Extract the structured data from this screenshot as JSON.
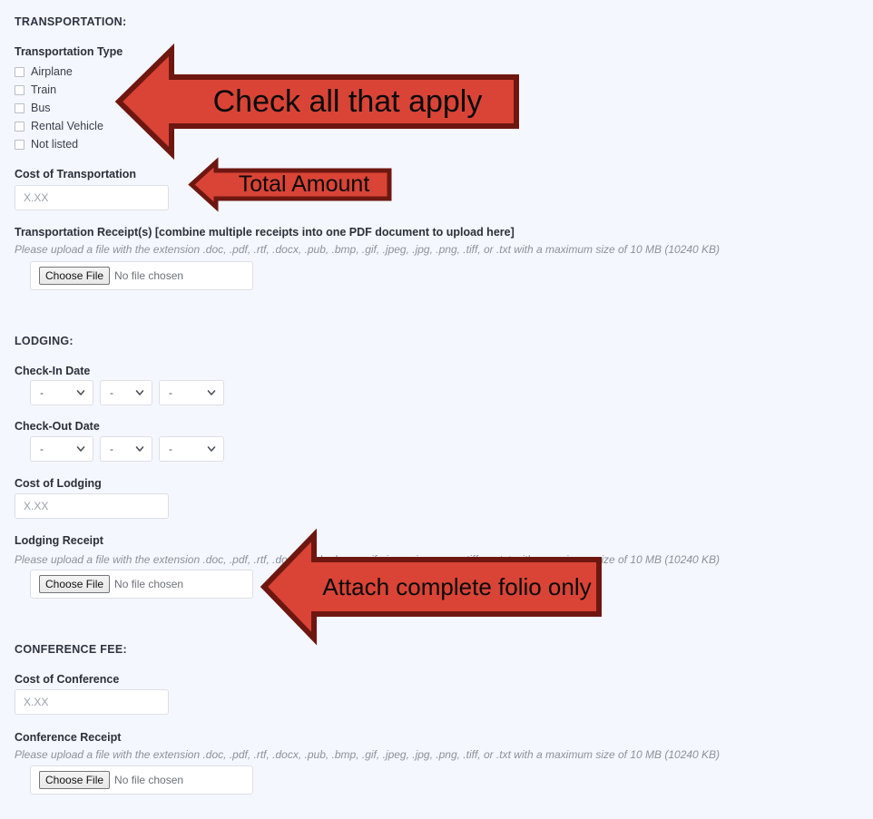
{
  "colors": {
    "page_background": "#f4f7fd",
    "arrow_fill": "#d94436",
    "arrow_stroke": "#6e1711",
    "arrow_text": "#0a0a0a",
    "label_text": "#2b3038",
    "help_text": "#8d919a"
  },
  "sections": {
    "transportation": {
      "heading": "TRANSPORTATION:",
      "type_label": "Transportation Type",
      "checkboxes": [
        {
          "label": "Airplane",
          "checked": false
        },
        {
          "label": "Train",
          "checked": false
        },
        {
          "label": "Bus",
          "checked": false
        },
        {
          "label": "Rental Vehicle",
          "checked": false
        },
        {
          "label": "Not listed",
          "checked": false
        }
      ],
      "cost_label": "Cost of Transportation",
      "cost_placeholder": "X.XX",
      "cost_value": "",
      "receipt_label": "Transportation Receipt(s) [combine multiple receipts into one PDF document to upload here]",
      "receipt_help": "Please upload a file with the extension .doc, .pdf, .rtf, .docx, .pub, .bmp, .gif, .jpeg, .jpg, .png, .tiff, or .txt with a maximum size of 10 MB (10240 KB)",
      "choose_file_label": "Choose File",
      "no_file_label": "No file chosen"
    },
    "lodging": {
      "heading": "LODGING:",
      "checkin_label": "Check-In Date",
      "checkout_label": "Check-Out Date",
      "date_select_value": "-",
      "cost_label": "Cost of Lodging",
      "cost_placeholder": "X.XX",
      "cost_value": "",
      "receipt_label": "Lodging Receipt",
      "receipt_help": "Please upload a file with the extension .doc, .pdf, .rtf, .docx, .pub, .bmp, .gif, .jpeg, .jpg, .png, .tiff, or .txt with a maximum size of 10 MB (10240 KB)",
      "choose_file_label": "Choose File",
      "no_file_label": "No file chosen"
    },
    "conference": {
      "heading": "CONFERENCE FEE:",
      "cost_label": "Cost of Conference",
      "cost_placeholder": "X.XX",
      "cost_value": "",
      "receipt_label": "Conference Receipt",
      "receipt_help": "Please upload a file with the extension .doc, .pdf, .rtf, .docx, .pub, .bmp, .gif, .jpeg, .jpg, .png, .tiff, or .txt with a maximum size of 10 MB (10240 KB)",
      "choose_file_label": "Choose File",
      "no_file_label": "No file chosen"
    }
  },
  "annotations": [
    {
      "id": "check-all",
      "text": "Check all that apply",
      "direction": "left",
      "font_size": 34
    },
    {
      "id": "total-amount",
      "text": "Total Amount",
      "direction": "left",
      "font_size": 25
    },
    {
      "id": "attach-folio",
      "text": "Attach complete folio only",
      "direction": "left",
      "font_size": 26
    }
  ]
}
